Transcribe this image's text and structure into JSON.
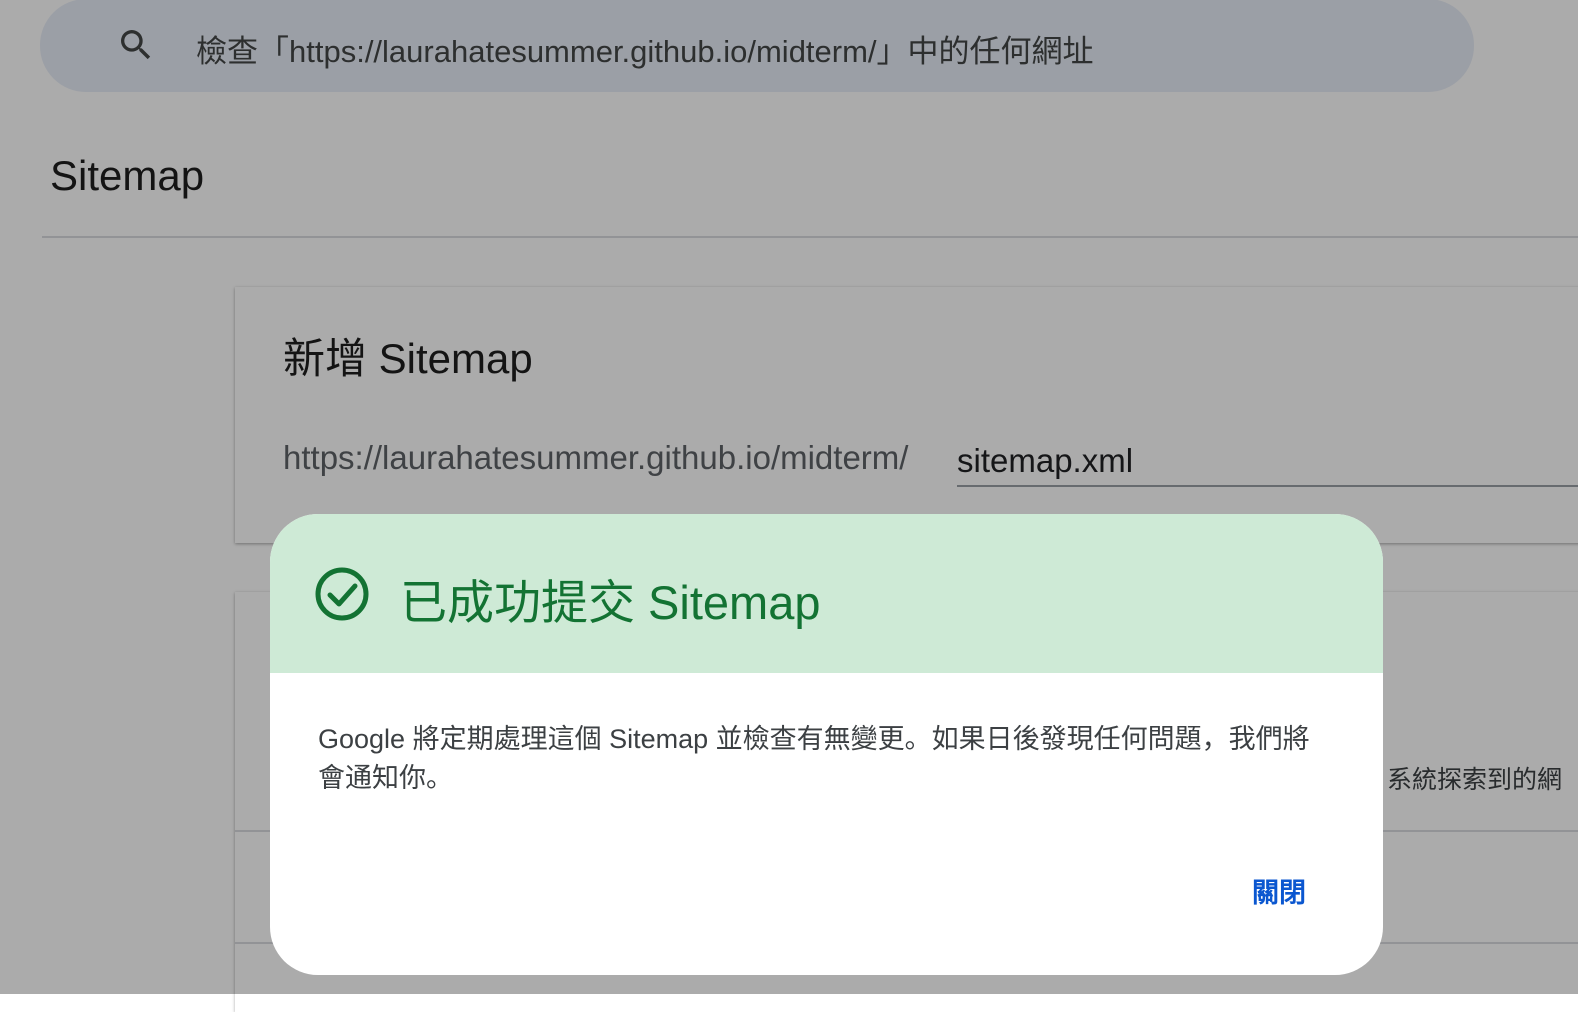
{
  "search": {
    "placeholder": "檢查「https://laurahatesummer.github.io/midterm/」中的任何網址",
    "icon": "search-icon"
  },
  "page": {
    "title": "Sitemap"
  },
  "add_sitemap": {
    "title": "新增 Sitemap",
    "url_prefix": "https://laurahatesummer.github.io/midterm/",
    "input_value": "sitemap.xml"
  },
  "sitemap_list": {
    "partial_text": "系統探索到的網"
  },
  "dialog": {
    "icon": "check-circle-icon",
    "title": "已成功提交 Sitemap",
    "body": "Google 將定期處理這個 Sitemap 並檢查有無變更。如果日後發現任何問題，我們將會通知你。",
    "close_label": "關閉",
    "colors": {
      "header_bg": "#ceead6",
      "success": "#137333",
      "action": "#0b57d0"
    }
  }
}
